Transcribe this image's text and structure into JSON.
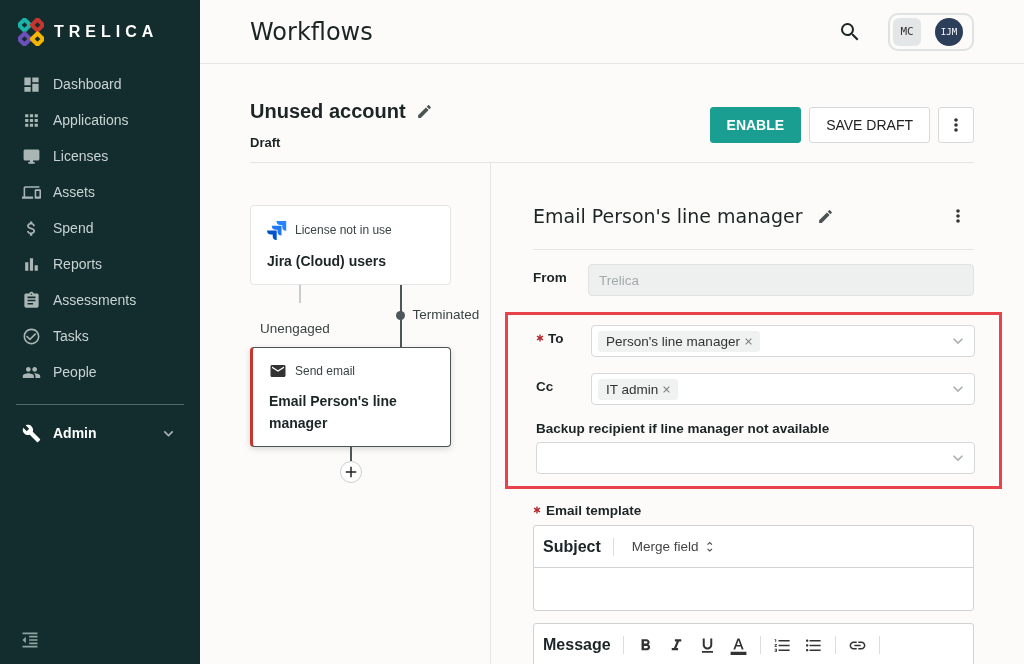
{
  "brand": {
    "name": "TRELICA"
  },
  "sidebar": {
    "items": [
      {
        "label": "Dashboard"
      },
      {
        "label": "Applications"
      },
      {
        "label": "Licenses"
      },
      {
        "label": "Assets"
      },
      {
        "label": "Spend"
      },
      {
        "label": "Reports"
      },
      {
        "label": "Assessments"
      },
      {
        "label": "Tasks"
      },
      {
        "label": "People"
      }
    ],
    "admin": {
      "label": "Admin",
      "expanded": false
    }
  },
  "header": {
    "title": "Workflows",
    "avatars": [
      {
        "initials": "MC",
        "selected": true
      },
      {
        "initials": "IJM",
        "selected": false
      }
    ]
  },
  "workflow": {
    "name": "Unused account",
    "status": "Draft",
    "buttons": [
      {
        "label": "ENABLE",
        "kind": "primary"
      },
      {
        "label": "SAVE DRAFT",
        "kind": "secondary"
      }
    ]
  },
  "canvas": {
    "trigger": {
      "type": "License not in use",
      "title": "Jira (Cloud) users"
    },
    "branches": [
      {
        "label": "Unengaged",
        "active": false
      },
      {
        "label": "Terminated",
        "active": true
      }
    ],
    "action": {
      "type": "Send email",
      "title": "Email Person's line manager",
      "selected": true
    }
  },
  "panel": {
    "title": "Email Person's line manager",
    "from": {
      "label": "From",
      "value": "Trelica",
      "disabled": true
    },
    "recipients": {
      "highlighted": true,
      "to": {
        "label": "To",
        "required": true,
        "tags": [
          "Person's line manager"
        ]
      },
      "cc": {
        "label": "Cc",
        "required": false,
        "tags": [
          "IT admin"
        ]
      },
      "backup": {
        "label": "Backup recipient if line manager not available"
      }
    },
    "template": {
      "label": "Email template",
      "required": true,
      "subject_label": "Subject",
      "merge_field": "Merge field",
      "message_label": "Message"
    }
  }
}
